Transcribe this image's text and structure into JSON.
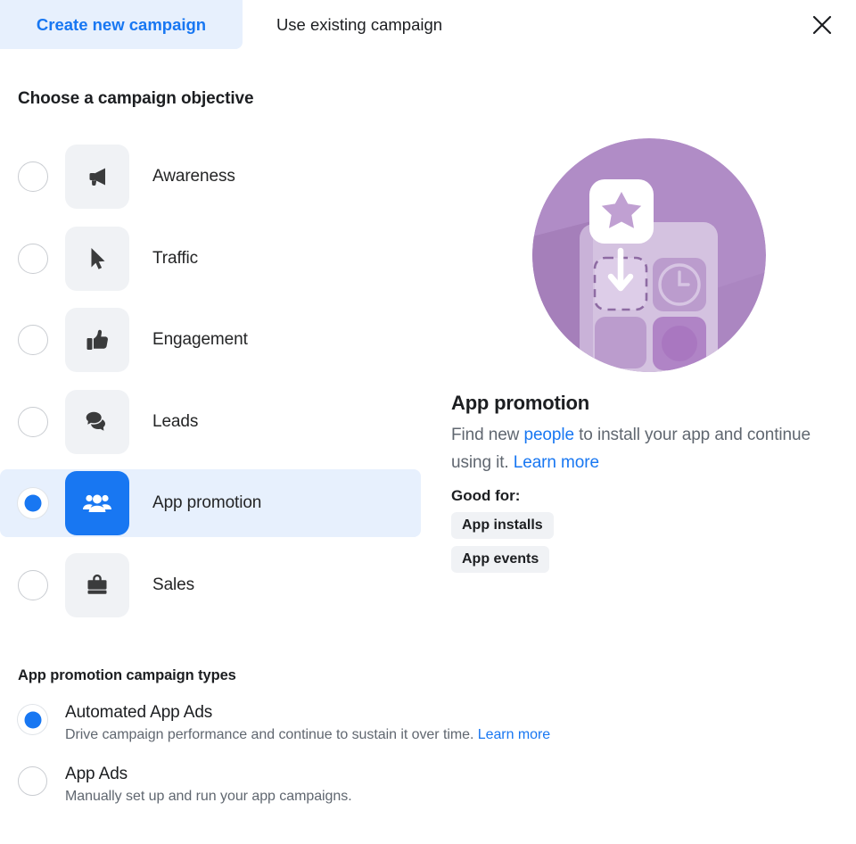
{
  "tabs": {
    "create_label": "Create new campaign",
    "existing_label": "Use existing campaign",
    "close_icon": "close-icon"
  },
  "objective_section": {
    "title": "Choose a campaign objective",
    "items": [
      {
        "label": "Awareness",
        "icon": "megaphone-icon",
        "selected": false
      },
      {
        "label": "Traffic",
        "icon": "cursor-icon",
        "selected": false
      },
      {
        "label": "Engagement",
        "icon": "thumbs-up-icon",
        "selected": false
      },
      {
        "label": "Leads",
        "icon": "chat-bubbles-icon",
        "selected": false
      },
      {
        "label": "App promotion",
        "icon": "people-icon",
        "selected": true
      },
      {
        "label": "Sales",
        "icon": "briefcase-icon",
        "selected": false
      }
    ]
  },
  "detail": {
    "illustration": "app-promotion-illustration",
    "heading": "App promotion",
    "desc_part1": "Find new ",
    "desc_link1": "people",
    "desc_part2": " to install your app and continue using it. ",
    "desc_link2": "Learn more",
    "good_for_label": "Good for:",
    "badges": [
      "App installs",
      "App events"
    ]
  },
  "types_section": {
    "title": "App promotion campaign types",
    "items": [
      {
        "title": "Automated App Ads",
        "desc": "Drive campaign performance and continue to sustain it over time. ",
        "link": "Learn more",
        "selected": true
      },
      {
        "title": "App Ads",
        "desc": "Manually set up and run your app campaigns.",
        "link": "",
        "selected": false
      }
    ]
  },
  "colors": {
    "accent_blue": "#1877f2",
    "selected_row_bg": "#e7f0fd",
    "tile_gray": "#f0f2f5",
    "illus_purple": "#b08cc6",
    "illus_purple_dark": "#a481b8",
    "illus_panel": "#cdb8da",
    "text_secondary": "#606770"
  }
}
